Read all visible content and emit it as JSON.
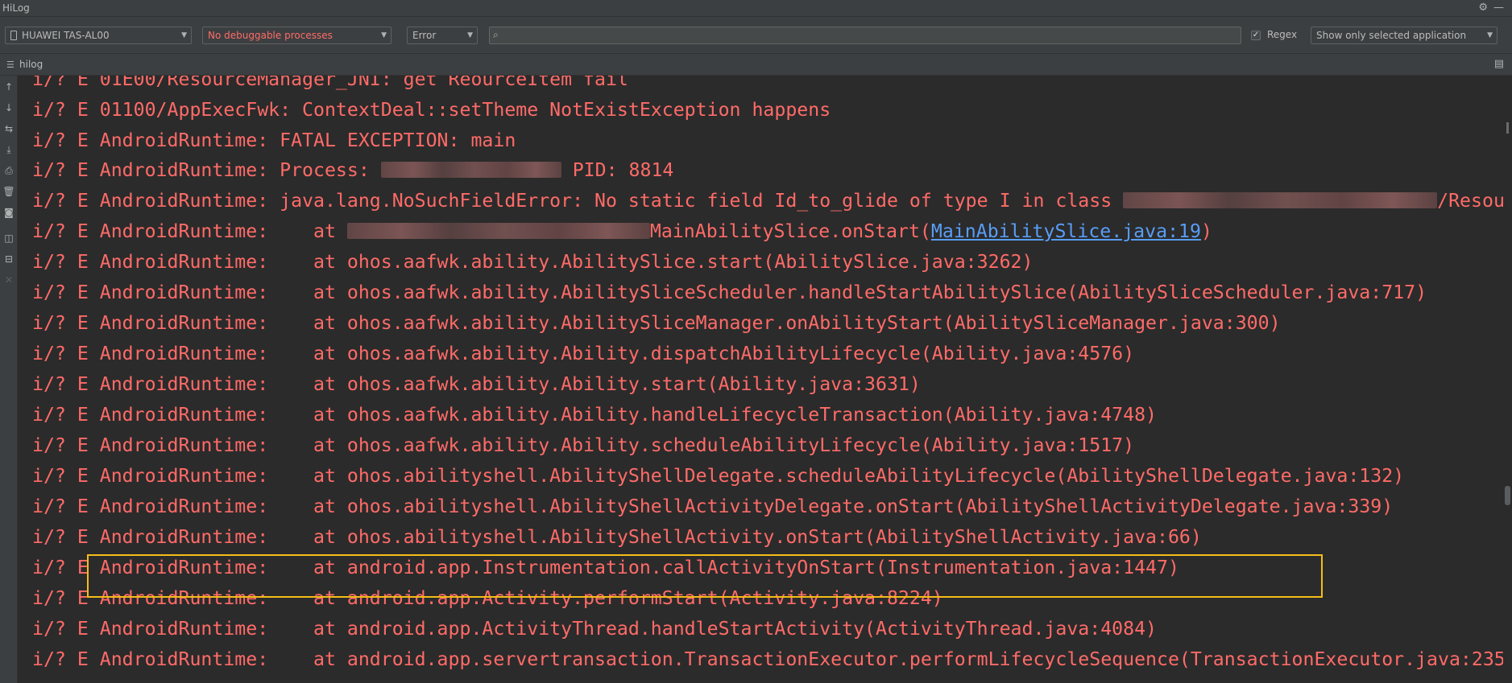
{
  "window": {
    "title": "HiLog"
  },
  "toolbar": {
    "device": "HUAWEI TAS-AL00",
    "process": "No debuggable processes",
    "level": "Error",
    "search_value": "",
    "regex_checked": true,
    "regex_label": "Regex",
    "filter": "Show only selected application"
  },
  "tab": {
    "label": "hilog"
  },
  "colors": {
    "log_error": "#ff6b68",
    "link": "#589df6",
    "highlight": "#f5bd19",
    "panel": "#3c3f41",
    "editor": "#2b2b2b"
  },
  "log": {
    "lines": [
      {
        "pre": "i/? E 01E00/ResourceManager_JNI: get ReourceItem fail"
      },
      {
        "pre": "i/? E 01100/AppExecFwk: ContextDeal::setTheme NotExistException happens"
      },
      {
        "pre": "i/? E AndroidRuntime: FATAL EXCEPTION: main"
      },
      {
        "pre": "i/? E AndroidRuntime: Process: ",
        "post": " PID: 8814"
      },
      {
        "pre": "i/? E AndroidRuntime: java.lang.NoSuchFieldError: No static field Id_to_glide of type I in class ",
        "post": "/Resour"
      },
      {
        "pre": "i/? E AndroidRuntime:    at ",
        "post": "MainAbilitySlice.onStart(",
        "link": "MainAbilitySlice.java:19",
        "tail": ")"
      },
      {
        "pre": "i/? E AndroidRuntime:    at ohos.aafwk.ability.AbilitySlice.start(AbilitySlice.java:3262)"
      },
      {
        "pre": "i/? E AndroidRuntime:    at ohos.aafwk.ability.AbilitySliceScheduler.handleStartAbilitySlice(AbilitySliceScheduler.java:717)"
      },
      {
        "pre": "i/? E AndroidRuntime:    at ohos.aafwk.ability.AbilitySliceManager.onAbilityStart(AbilitySliceManager.java:300)"
      },
      {
        "pre": "i/? E AndroidRuntime:    at ohos.aafwk.ability.Ability.dispatchAbilityLifecycle(Ability.java:4576)"
      },
      {
        "pre": "i/? E AndroidRuntime:    at ohos.aafwk.ability.Ability.start(Ability.java:3631)"
      },
      {
        "pre": "i/? E AndroidRuntime:    at ohos.aafwk.ability.Ability.handleLifecycleTransaction(Ability.java:4748)"
      },
      {
        "pre": "i/? E AndroidRuntime:    at ohos.aafwk.ability.Ability.scheduleAbilityLifecycle(Ability.java:1517)"
      },
      {
        "pre": "i/? E AndroidRuntime:    at ohos.abilityshell.AbilityShellDelegate.scheduleAbilityLifecycle(AbilityShellDelegate.java:132)"
      },
      {
        "pre": "i/? E AndroidRuntime:    at ohos.abilityshell.AbilityShellActivityDelegate.onStart(AbilityShellActivityDelegate.java:339)"
      },
      {
        "pre": "i/? E AndroidRuntime:    at ohos.abilityshell.AbilityShellActivity.onStart(AbilityShellActivity.java:66)"
      },
      {
        "pre": "i/? E AndroidRuntime:    at android.app.Instrumentation.callActivityOnStart(Instrumentation.java:1447)"
      },
      {
        "pre": "i/? E AndroidRuntime:    at android.app.Activity.performStart(Activity.java:8224)"
      },
      {
        "pre": "i/? E AndroidRuntime:    at android.app.ActivityThread.handleStartActivity(ActivityThread.java:4084)"
      },
      {
        "pre": "i/? E AndroidRuntime:    at android.app.servertransaction.TransactionExecutor.performLifecycleSequence(TransactionExecutor.java:235"
      }
    ]
  }
}
